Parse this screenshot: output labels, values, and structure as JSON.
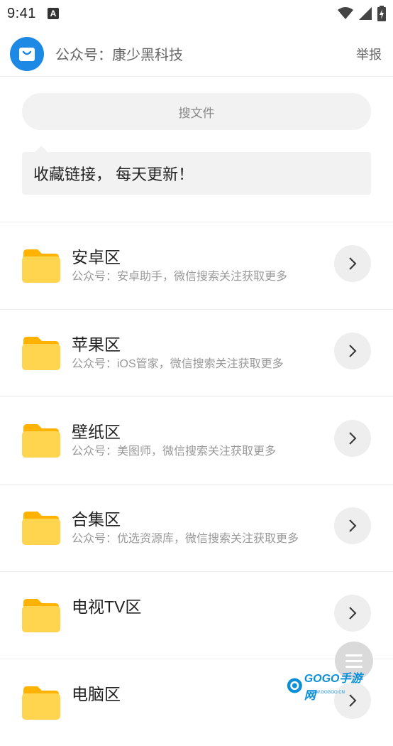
{
  "status_bar": {
    "time": "9:41",
    "notification_icon_letter": "A"
  },
  "header": {
    "title": "公众号：康少黑科技",
    "report": "举报"
  },
  "search": {
    "label": "搜文件"
  },
  "message": "收藏链接， 每天更新！",
  "items": [
    {
      "title": "安卓区",
      "subtitle": "公众号：安卓助手，微信搜索关注获取更多"
    },
    {
      "title": "苹果区",
      "subtitle": "公众号：iOS管家，微信搜索关注获取更多"
    },
    {
      "title": "壁纸区",
      "subtitle": "公众号：美图师，微信搜索关注获取更多"
    },
    {
      "title": "合集区",
      "subtitle": "公众号：优选资源库，微信搜索关注获取更多"
    },
    {
      "title": "电视TV区",
      "subtitle": ""
    },
    {
      "title": "电脑区",
      "subtitle": ""
    }
  ],
  "watermark": {
    "brand": "GOGO手游网",
    "url": "WWW.GOGOO.CN"
  },
  "colors": {
    "accent_blue": "#1e88e5",
    "folder_yellow": "#ffd54f",
    "folder_tab": "#ffb300"
  }
}
